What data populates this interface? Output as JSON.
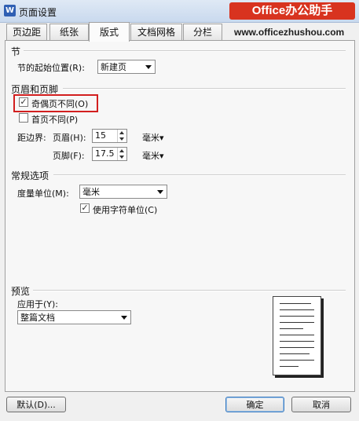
{
  "window": {
    "title": "页面设置",
    "app_icon": "W",
    "brand_watermark": "Office办公助手",
    "watermark_url": "www.officezhushou.com"
  },
  "tabs": [
    "页边距",
    "纸张",
    "版式",
    "文档网格",
    "分栏"
  ],
  "active_tab": "版式",
  "section": {
    "heading": "节",
    "start_label": "节的起始位置(R):",
    "start_value": "新建页"
  },
  "header_footer": {
    "heading": "页眉和页脚",
    "odd_even_label": "奇偶页不同(O)",
    "odd_even_checked": true,
    "first_page_label": "首页不同(P)",
    "first_page_checked": false,
    "distance_label": "距边界:",
    "header_label": "页眉(H):",
    "header_value": "15",
    "header_unit": "毫米",
    "footer_label": "页脚(F):",
    "footer_value": "17.5",
    "footer_unit": "毫米"
  },
  "general": {
    "heading": "常规选项",
    "unit_label": "度量单位(M):",
    "unit_value": "毫米",
    "char_unit_label": "使用字符单位(C)",
    "char_unit_checked": true
  },
  "preview": {
    "heading": "预览",
    "apply_label": "应用于(Y):",
    "apply_value": "整篇文档"
  },
  "buttons": {
    "default": "默认(D)...",
    "ok": "确定",
    "cancel": "取消"
  },
  "colors": {
    "highlight_box": "#d21f1f",
    "brand": "#d8331f"
  }
}
